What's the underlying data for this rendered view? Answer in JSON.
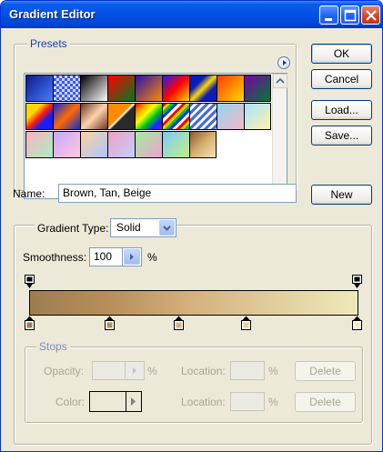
{
  "window": {
    "title": "Gradient Editor",
    "titlebar_color": "#0052e6",
    "buttons": [
      "minimize-icon",
      "maximize-icon",
      "close-icon"
    ]
  },
  "presets": {
    "title": "Presets",
    "menu_icon": "play-circle-icon",
    "swatches": [
      "linear-gradient(135deg,#0a1c8a,#4a7aff)",
      "repeating-conic-gradient(#3b55f0 0 25%,#c9d6ff 0 50%) 0 0/6px 6px",
      "linear-gradient(135deg,#000,#fff)",
      "linear-gradient(135deg,#ff0000,#007a1f)",
      "linear-gradient(135deg,#2a0fb0,#ff8a00)",
      "linear-gradient(135deg,#1a1cff,#ff0000,#ffd800)",
      "linear-gradient(135deg,#0a1cb8 30%,#ffd800 50%,#0a1cb8 70%)",
      "linear-gradient(135deg,#ff3a00,#ffd800)",
      "linear-gradient(135deg,#7a00a8,#007a30)",
      "linear-gradient(135deg,#ffd800 30%,#ff2000 50%,#1a1cff 70%)",
      "linear-gradient(135deg,#0a2cd8,#ff6a00 50%,#0a2cd8)",
      "linear-gradient(135deg,#6a3a1a,#ffd2b0 50%,#6a3a1a)",
      "linear-gradient(135deg,#ff8a00 45%,#ffffff 50%,#2a2a2a 55%)",
      "linear-gradient(135deg,#ff0000,#ff9900,#ffff00,#00cc00,#0033ff,#9900cc)",
      "repeating-linear-gradient(135deg,#ff0000 0 3px,#ffcc00 3px 6px,#00cc00 6px 9px,#0033ff 9px 12px,#ffffff 12px 15px)",
      "repeating-linear-gradient(135deg,#4a6ad8 0 3px,#ffffff 3px 6px)",
      "linear-gradient(135deg,#8fd6f0,#f7b7c8)",
      "linear-gradient(135deg,#a8e4ff,#fff2a8)",
      "linear-gradient(135deg,#ffb0c0,#a8f0c0)",
      "linear-gradient(135deg,#c8a8ff,#ffc8d8)",
      "linear-gradient(135deg,#ffd0a0,#a8c8ff)",
      "linear-gradient(135deg,#f0a0c0,#c0d0ff)",
      "linear-gradient(135deg,#a0f0a0,#f0a0d0)",
      "linear-gradient(135deg,#80c8ff,#c0f080)",
      "linear-gradient(135deg,#8b5a2b,#d8b070 50%,#f0e4b8)"
    ]
  },
  "buttons": {
    "ok": "OK",
    "cancel": "Cancel",
    "load": "Load...",
    "save": "Save...",
    "new": "New"
  },
  "name_field": {
    "label": "Name:",
    "value": "Brown, Tan, Beige"
  },
  "gradient": {
    "type_label": "Gradient Type:",
    "type_value": "Solid",
    "smoothness_label": "Smoothness:",
    "smoothness_value": "100",
    "smoothness_unit": "%",
    "colors": [
      "#9d7d4f",
      "#b98f5a",
      "#d5b27f",
      "#e1cf9c",
      "#efe9bb"
    ],
    "opacity_stops": [
      "#000000",
      "#000000"
    ],
    "color_stops": [
      "#9d7d4f",
      "#b98f5a",
      "#d5b27f",
      "#e1cf9c",
      "#efe9bb"
    ]
  },
  "stops": {
    "title": "Stops",
    "opacity_label": "Opacity:",
    "opacity_unit": "%",
    "color_label": "Color:",
    "location_label": "Location:",
    "location_unit": "%",
    "delete_label": "Delete"
  }
}
